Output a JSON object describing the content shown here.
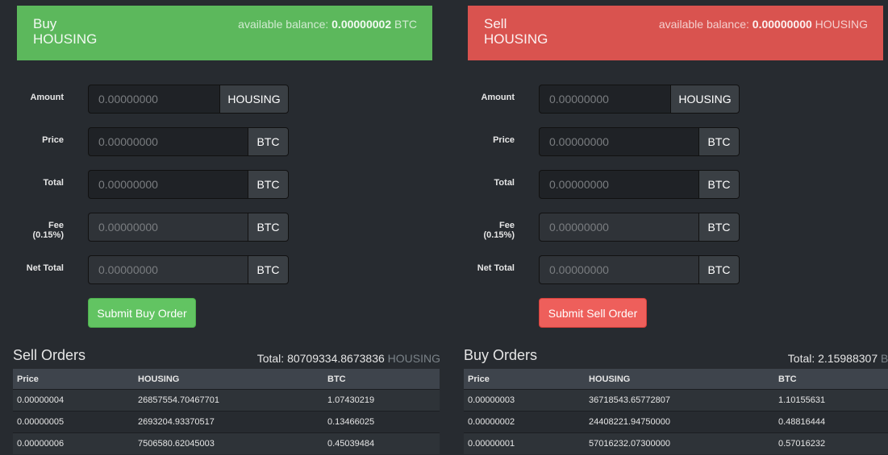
{
  "buy": {
    "title_line1": "Buy",
    "title_line2": "HOUSING",
    "balance_prefix": "available balance:",
    "balance_value": "0.00000002",
    "balance_unit": "BTC",
    "fields": [
      {
        "label": "Amount",
        "value": "0.00000000",
        "unit": "HOUSING"
      },
      {
        "label": "Price",
        "value": "0.00000000",
        "unit": "BTC"
      },
      {
        "label": "Total",
        "value": "0.00000000",
        "unit": "BTC"
      },
      {
        "label": "Fee (0.15%)",
        "value": "0.00000000",
        "unit": "BTC"
      },
      {
        "label": "Net Total",
        "value": "0.00000000",
        "unit": "BTC"
      }
    ],
    "submit_label": "Submit Buy Order",
    "accent": "#5cb85c"
  },
  "sell": {
    "title_line1": "Sell",
    "title_line2": "HOUSING",
    "balance_prefix": "available balance:",
    "balance_value": "0.00000000",
    "balance_unit": "HOUSING",
    "fields": [
      {
        "label": "Amount",
        "value": "0.00000000",
        "unit": "HOUSING"
      },
      {
        "label": "Price",
        "value": "0.00000000",
        "unit": "BTC"
      },
      {
        "label": "Total",
        "value": "0.00000000",
        "unit": "BTC"
      },
      {
        "label": "Fee (0.15%)",
        "value": "0.00000000",
        "unit": "BTC"
      },
      {
        "label": "Net Total",
        "value": "0.00000000",
        "unit": "BTC"
      }
    ],
    "submit_label": "Submit Sell Order",
    "accent": "#d9534f"
  },
  "sell_orders": {
    "title": "Sell Orders",
    "total_prefix": "Total:",
    "total_value": "80709334.8673836",
    "total_unit": "HOUSING",
    "columns": [
      "Price",
      "HOUSING",
      "BTC"
    ],
    "rows": [
      [
        "0.00000004",
        "26857554.70467701",
        "1.07430219"
      ],
      [
        "0.00000005",
        "2693204.93370517",
        "0.13466025"
      ],
      [
        "0.00000006",
        "7506580.62045003",
        "0.45039484"
      ]
    ]
  },
  "buy_orders": {
    "title": "Buy Orders",
    "total_prefix": "Total:",
    "total_value": "2.15988307",
    "total_unit": "BTC",
    "columns": [
      "Price",
      "HOUSING",
      "BTC"
    ],
    "rows": [
      [
        "0.00000003",
        "36718543.65772807",
        "1.10155631"
      ],
      [
        "0.00000002",
        "24408221.94750000",
        "0.48816444"
      ],
      [
        "0.00000001",
        "57016232.07300000",
        "0.57016232"
      ]
    ]
  }
}
